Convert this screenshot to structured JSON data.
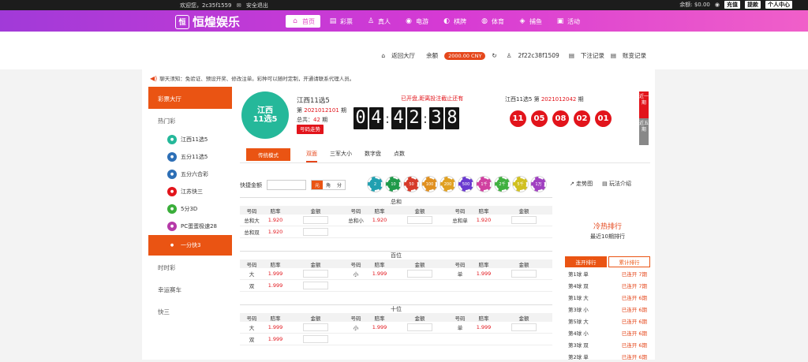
{
  "topbar": {
    "welcome": "欢迎您，2c35f1559",
    "logout": "安全退出",
    "balance_label": "余额: $0.00",
    "recharge": "充值",
    "withdraw": "提款",
    "personal": "个人中心"
  },
  "brand": {
    "mark": "恒",
    "name": "恒煌娱乐"
  },
  "nav": [
    {
      "label": "首页",
      "icon": "⌂",
      "active": true
    },
    {
      "label": "彩票",
      "icon": "▤"
    },
    {
      "label": "真人",
      "icon": "♙"
    },
    {
      "label": "电游",
      "icon": "◉"
    },
    {
      "label": "棋牌",
      "icon": "◐"
    },
    {
      "label": "体育",
      "icon": "◍"
    },
    {
      "label": "捕鱼",
      "icon": "◈"
    },
    {
      "label": "活动",
      "icon": "▣"
    }
  ],
  "subbar": {
    "back_hall": "返回大厅",
    "balance_label": "余额",
    "balance_value": "2000.00 CNY",
    "user": "2f22c38f1509",
    "bet_record": "下注记录",
    "trade_record": "账变记录"
  },
  "notice": "聊天须知：免验证、预设开奖、修改注单。彩种可以随时定制，开通请联系代理人员。",
  "sidebar": {
    "head": "彩票大厅",
    "group_hot": "热门彩",
    "items": [
      {
        "label": "江西11选5",
        "color": "#25b89a"
      },
      {
        "label": "五分11选5",
        "color": "#2d6fb6"
      },
      {
        "label": "五分六合彩",
        "color": "#2d6fb6"
      },
      {
        "label": "江苏快三",
        "color": "#e2141b"
      },
      {
        "label": "5分3D",
        "color": "#3aae3a"
      },
      {
        "label": "PC蛋蛋极速28",
        "color": "#b63aa8"
      },
      {
        "label": "一分快3",
        "color": "#ea5413",
        "active": true
      }
    ],
    "group_time": "时时彩",
    "group_race": "幸运赛车",
    "group_k3": "快三"
  },
  "lottery": {
    "logo_line1": "江西",
    "logo_line2": "11选5",
    "name": "江西11选5",
    "issue_prefix": "第",
    "issue": "2021012101",
    "issue_suffix": "期",
    "total_label": "总共：",
    "total": "42",
    "total_suffix": "期",
    "trend_btn": "号码走势",
    "countdown_label": "已开盘,距离投注截止还有",
    "countdown": [
      "0",
      "4",
      "4",
      "2",
      "3",
      "8"
    ],
    "result_name": "江西11选5 第",
    "result_issue": "2021012042",
    "result_suffix": "期",
    "balls": [
      "11",
      "05",
      "08",
      "02",
      "01"
    ],
    "vtab1": "近一期",
    "vtab2": "近五期"
  },
  "mode_btn": "传统模式",
  "play_tabs": [
    "双面",
    "三军大小",
    "数字盘",
    "点数"
  ],
  "quick": {
    "label": "快捷金额",
    "seg": [
      "元",
      "角",
      "分"
    ]
  },
  "chips": [
    {
      "v": "2",
      "c": "#20a0b0"
    },
    {
      "v": "10",
      "c": "#1f9a4a"
    },
    {
      "v": "50",
      "c": "#d63a2a"
    },
    {
      "v": "100",
      "c": "#e09020"
    },
    {
      "v": "200",
      "c": "#e0a020"
    },
    {
      "v": "500",
      "c": "#6a3ad0"
    },
    {
      "v": "1千",
      "c": "#d040a0"
    },
    {
      "v": "2千",
      "c": "#40b040"
    },
    {
      "v": "5千",
      "c": "#d0c020"
    },
    {
      "v": "1万",
      "c": "#a040c0"
    }
  ],
  "tools": {
    "trend": "走势图",
    "rules": "玩法介绍"
  },
  "table_header": {
    "num": "号码",
    "odds": "赔率",
    "amount": "金额"
  },
  "sections": [
    {
      "title": "总和",
      "rows": [
        [
          {
            "n": "总和大",
            "o": "1.920"
          },
          {
            "n": "总和小",
            "o": "1.920"
          },
          {
            "n": "总和单",
            "o": "1.920"
          }
        ],
        [
          {
            "n": "总和双",
            "o": "1.920"
          }
        ]
      ]
    },
    {
      "title": "百位",
      "rows": [
        [
          {
            "n": "大",
            "o": "1.999"
          },
          {
            "n": "小",
            "o": "1.999"
          },
          {
            "n": "单",
            "o": "1.999"
          }
        ],
        [
          {
            "n": "双",
            "o": "1.999"
          }
        ]
      ]
    },
    {
      "title": "十位",
      "rows": [
        [
          {
            "n": "大",
            "o": "1.999"
          },
          {
            "n": "小",
            "o": "1.999"
          },
          {
            "n": "单",
            "o": "1.999"
          }
        ],
        [
          {
            "n": "双",
            "o": "1.999"
          }
        ]
      ]
    }
  ],
  "hot": {
    "title": "冷热排行",
    "subtitle": "最近10期排行",
    "tab1": "连开排行",
    "tab2": "累计排行",
    "rows": [
      {
        "k": "第1球 单",
        "v": "已连开 7期"
      },
      {
        "k": "第4球 双",
        "v": "已连开 7期"
      },
      {
        "k": "第1球 大",
        "v": "已连开 6期"
      },
      {
        "k": "第3球 小",
        "v": "已连开 6期"
      },
      {
        "k": "第5球 大",
        "v": "已连开 6期"
      },
      {
        "k": "第4球 小",
        "v": "已连开 6期"
      },
      {
        "k": "第3球 双",
        "v": "已连开 6期"
      },
      {
        "k": "第2球 单",
        "v": "已连开 6期"
      }
    ]
  }
}
